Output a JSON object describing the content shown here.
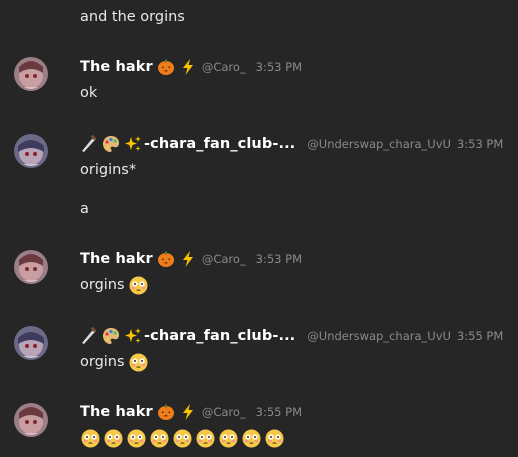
{
  "messages": [
    {
      "continuation": true,
      "text": "and the orgins"
    },
    {
      "author": "The hakr",
      "handle": "@Caro_",
      "time": "3:53 PM",
      "badges": [
        "jack-o-lantern-icon",
        "lightning-icon"
      ],
      "text": "ok"
    },
    {
      "author": "-chara_fan_club-...",
      "handle": "@Underswap_chara_UvU",
      "time": "3:53 PM",
      "prefix_badges": [
        "knife-icon",
        "palette-icon",
        "sparkles-icon"
      ],
      "text": "origins*",
      "text2": "a"
    },
    {
      "author": "The hakr",
      "handle": "@Caro_",
      "time": "3:53 PM",
      "badges": [
        "jack-o-lantern-icon",
        "lightning-icon"
      ],
      "text": "orgins",
      "emoji": "flushed-face-icon"
    },
    {
      "author": "-chara_fan_club-...",
      "handle": "@Underswap_chara_UvU",
      "time": "3:55 PM",
      "prefix_badges": [
        "knife-icon",
        "palette-icon",
        "sparkles-icon"
      ],
      "text": "orgins",
      "emoji": "flushed-face-icon"
    },
    {
      "author": "The hakr",
      "handle": "@Caro_",
      "time": "3:55 PM",
      "badges": [
        "jack-o-lantern-icon",
        "lightning-icon"
      ],
      "emoji_count": 9,
      "emoji": "flushed-face-icon"
    }
  ],
  "colors": {
    "background": "#262626",
    "author": "#ffffff",
    "meta": "#8a8a8a",
    "text": "#e8e8e8"
  }
}
